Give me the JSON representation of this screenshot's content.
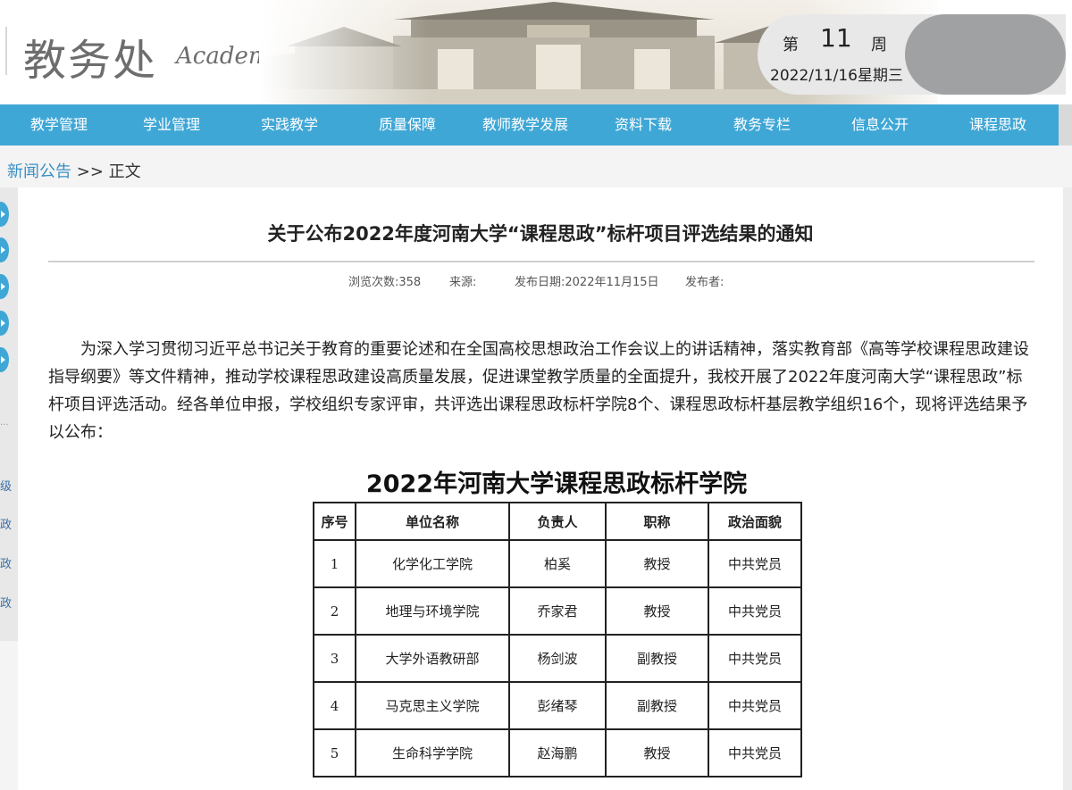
{
  "header": {
    "logo_cn": "教务处",
    "logo_en": "Academic Affairs Office",
    "week_prefix": "第",
    "week_number": "11",
    "week_suffix": "周",
    "date": "2022/11/16星期三"
  },
  "nav": {
    "items": [
      "教学管理",
      "学业管理",
      "实践教学",
      "质量保障",
      "教师教学发展",
      "资料下载",
      "教务专栏",
      "信息公开",
      "课程思政"
    ]
  },
  "breadcrumb": {
    "link": "新闻公告",
    "separator": ">>",
    "current": "正文"
  },
  "sidebar": {
    "dots": "...",
    "chars": [
      "级",
      "政",
      "政",
      "政"
    ]
  },
  "article": {
    "title": "关于公布2022年度河南大学“课程思政”标杆项目评选结果的通知",
    "views": "浏览次数:358",
    "source": "来源:",
    "publish_date": "发布日期:2022年11月15日",
    "publisher": "发布者:",
    "body": "为深入学习贯彻习近平总书记关于教育的重要论述和在全国高校思想政治工作会议上的讲话精神，落实教育部《高等学校课程思政建设指导纲要》等文件精神，推动学校课程思政建设高质量发展，促进课堂教学质量的全面提升，我校开展了2022年度河南大学“课程思政”标杆项目评选活动。经各单位申报，学校组织专家评审，共评选出课程思政标杆学院8个、课程思政标杆基层教学组织16个，现将评选结果予以公布："
  },
  "table_image": {
    "title": "2022年河南大学课程思政标杆学院",
    "headers": [
      "序号",
      "单位名称",
      "负责人",
      "职称",
      "政治面貌"
    ],
    "rows": [
      [
        "1",
        "化学化工学院",
        "柏奚",
        "教授",
        "中共党员"
      ],
      [
        "2",
        "地理与环境学院",
        "乔家君",
        "教授",
        "中共党员"
      ],
      [
        "3",
        "大学外语教研部",
        "杨剑波",
        "副教授",
        "中共党员"
      ],
      [
        "4",
        "马克思主义学院",
        "彭绪琴",
        "副教授",
        "中共党员"
      ],
      [
        "5",
        "生命科学学院",
        "赵海鹏",
        "教授",
        "中共党员"
      ]
    ]
  },
  "colors": {
    "nav_bg": "#3fa7d6",
    "link": "#3a8fc4"
  }
}
